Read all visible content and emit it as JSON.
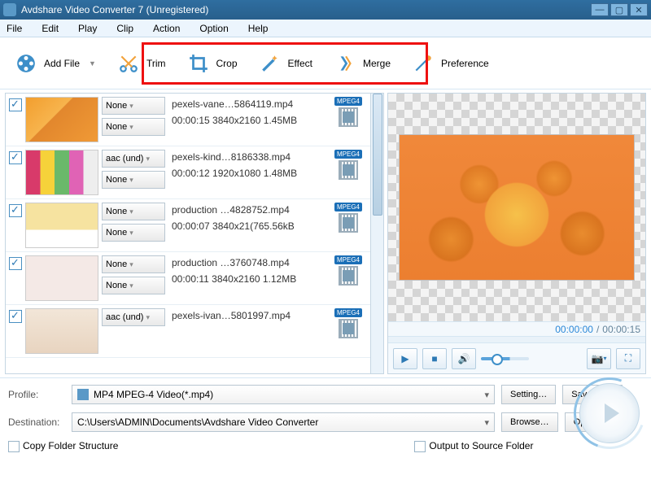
{
  "window": {
    "title": "Avdshare Video Converter 7 (Unregistered)"
  },
  "menu": {
    "file": "File",
    "edit": "Edit",
    "play": "Play",
    "clip": "Clip",
    "action": "Action",
    "option": "Option",
    "help": "Help"
  },
  "toolbar": {
    "addfile": "Add File",
    "trim": "Trim",
    "crop": "Crop",
    "effect": "Effect",
    "merge": "Merge",
    "preference": "Preference"
  },
  "files": [
    {
      "checked": true,
      "sel1": "None",
      "sel2": "None",
      "name": "pexels-vane…5864119.mp4",
      "meta": "00:00:15 3840x2160 1.45MB",
      "type": "MPEG4"
    },
    {
      "checked": true,
      "sel1": "aac (und)",
      "sel2": "None",
      "name": "pexels-kind…8186338.mp4",
      "meta": "00:00:12 1920x1080 1.48MB",
      "type": "MPEG4"
    },
    {
      "checked": true,
      "sel1": "None",
      "sel2": "None",
      "name": "production …4828752.mp4",
      "meta": "00:00:07 3840x21(765.56kB",
      "type": "MPEG4"
    },
    {
      "checked": true,
      "sel1": "None",
      "sel2": "None",
      "name": "production …3760748.mp4",
      "meta": "00:00:11 3840x2160 1.12MB",
      "type": "MPEG4"
    },
    {
      "checked": true,
      "sel1": "aac (und)",
      "sel2": "",
      "name": "pexels-ivan…5801997.mp4",
      "meta": "",
      "type": "MPEG4"
    }
  ],
  "preview": {
    "current": "00:00:00",
    "total": "00:00:15"
  },
  "bottom": {
    "profile_label": "Profile:",
    "profile_value": "MP4 MPEG-4 Video(*.mp4)",
    "setting": "Setting…",
    "saveas": "Save As…",
    "dest_label": "Destination:",
    "dest_value": "C:\\Users\\ADMIN\\Documents\\Avdshare Video Converter",
    "browse": "Browse…",
    "open": "Open Folder",
    "copy_folder": "Copy Folder Structure",
    "output_src": "Output to Source Folder"
  }
}
